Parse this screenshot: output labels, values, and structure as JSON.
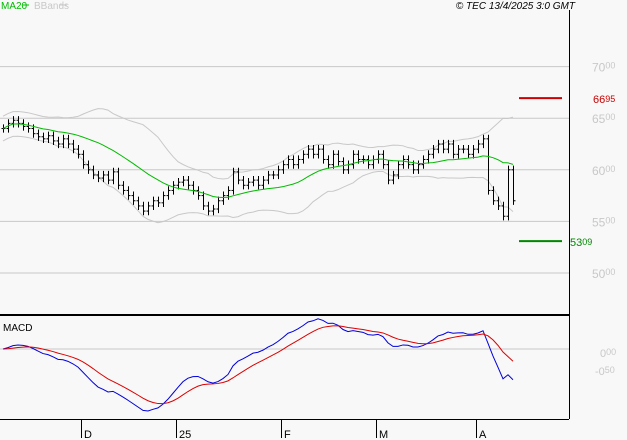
{
  "header": {
    "ma_label": "MA20",
    "bbands_label": "BBands",
    "copyright": "© TEC 13/4/2025 3:0 GMT"
  },
  "colors": {
    "ma": "#00bb00",
    "bbands": "#c8c8c8",
    "resistance": "#cc0000",
    "support": "#008800",
    "macd": "#0000dd",
    "signal": "#dd0000"
  },
  "chart_data": {
    "type": "ohlc",
    "title": "",
    "price_axis": {
      "ticks": [
        {
          "main": "70",
          "sub": "00",
          "value": 7000
        },
        {
          "main": "65",
          "sub": "00",
          "value": 6500
        },
        {
          "main": "60",
          "sub": "00",
          "value": 6000
        },
        {
          "main": "55",
          "sub": "00",
          "value": 5500
        },
        {
          "main": "50",
          "sub": "00",
          "value": 5000
        }
      ],
      "ylim": [
        4600,
        7500
      ]
    },
    "resistance": {
      "value": 6695,
      "label": "66",
      "sub": "95"
    },
    "support": {
      "value": 5309,
      "label": "53",
      "sub": "09"
    },
    "x_labels": [
      "D",
      "25",
      "F",
      "M",
      "A"
    ],
    "x_label_index": [
      16,
      35,
      56,
      75,
      95
    ],
    "closes": [
      6400,
      6450,
      6480,
      6450,
      6420,
      6400,
      6350,
      6320,
      6300,
      6330,
      6280,
      6250,
      6300,
      6250,
      6200,
      6150,
      6050,
      6000,
      5950,
      5920,
      5950,
      5900,
      5980,
      5850,
      5800,
      5750,
      5700,
      5650,
      5600,
      5650,
      5700,
      5680,
      5750,
      5800,
      5850,
      5880,
      5900,
      5850,
      5800,
      5750,
      5650,
      5600,
      5620,
      5700,
      5750,
      5800,
      5980,
      5900,
      5850,
      5880,
      5900,
      5850,
      5900,
      5950,
      5950,
      6000,
      6050,
      6100,
      6050,
      6100,
      6150,
      6200,
      6150,
      6200,
      6100,
      6050,
      6150,
      6080,
      6000,
      6050,
      6150,
      6100,
      6100,
      6050,
      6100,
      6150,
      6050,
      5900,
      5950,
      6050,
      6100,
      6050,
      6000,
      6050,
      6100,
      6150,
      6200,
      6250,
      6200,
      6250,
      6150,
      6200,
      6200,
      6150,
      6200,
      6250,
      6300,
      5800,
      5700,
      5650,
      5550,
      6000,
      5700
    ],
    "macd": {
      "label": "MACD",
      "ticks": [
        {
          "main": "0",
          "sub": "00"
        },
        {
          "main": "-0",
          "sub": "50"
        }
      ]
    }
  }
}
